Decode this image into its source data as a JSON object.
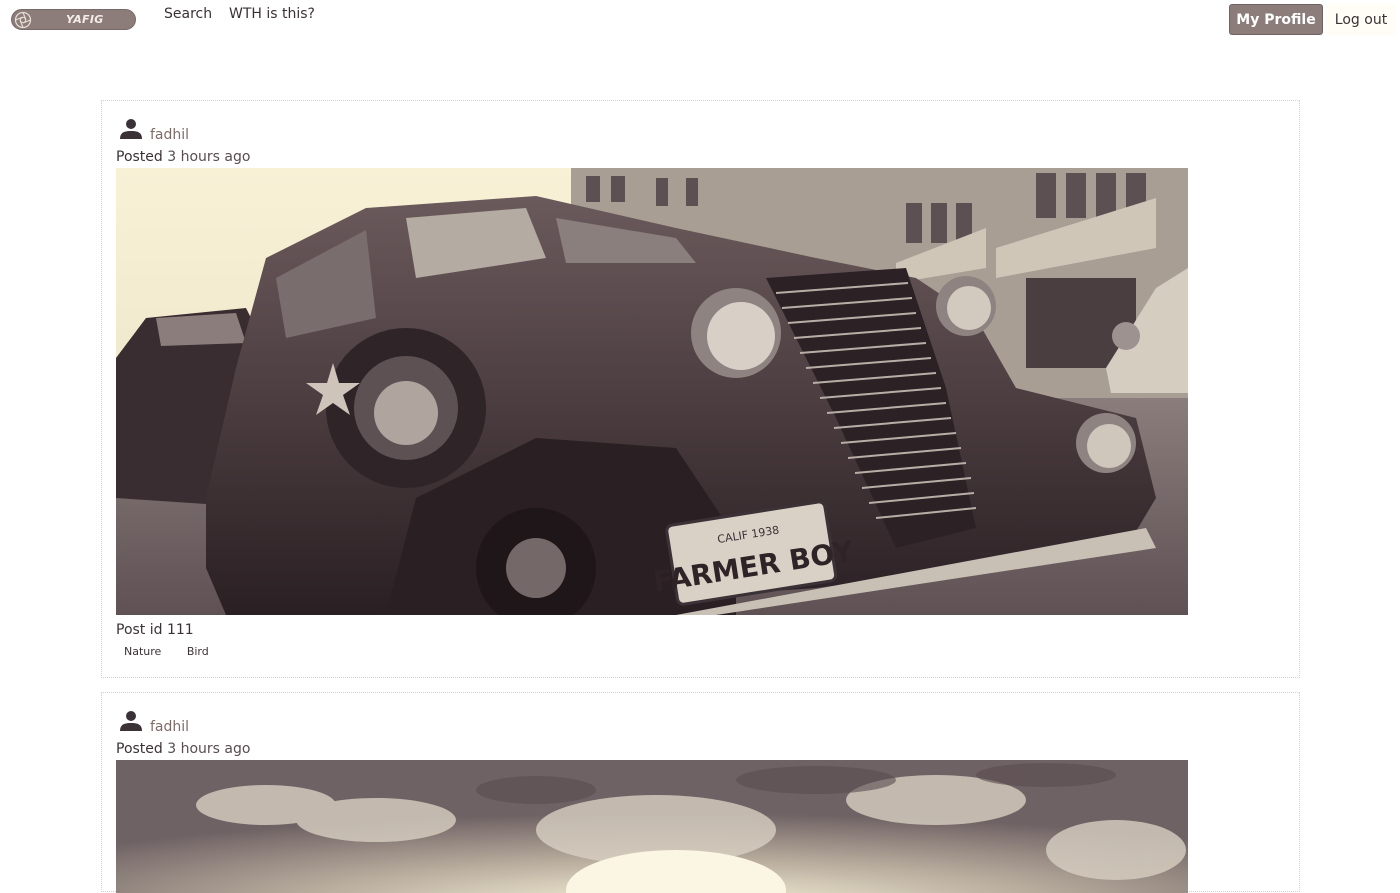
{
  "header": {
    "logo_text": "YAFIG",
    "nav": [
      {
        "label": "Search"
      },
      {
        "label": "WTH is this?"
      }
    ],
    "profile_button": "My Profile",
    "logout_button": "Log out"
  },
  "posts": [
    {
      "username": "fadhil",
      "posted_prefix": "Posted",
      "posted_time": "3 hours ago",
      "caption": "Post id 111",
      "tags": [
        "Nature",
        "Bird"
      ],
      "image": {
        "icon": "photo-vintage-car",
        "plate_line1": "CALIF 1938",
        "plate_line2": "FARMER BOY"
      }
    },
    {
      "username": "fadhil",
      "posted_prefix": "Posted",
      "posted_time": "3 hours ago",
      "image": {
        "icon": "photo-cloudy-sky"
      }
    }
  ],
  "colors": {
    "accent": "#8c7d7a",
    "text": "#3b3237",
    "link": "#7d6b66",
    "sepia_light": "#f6efd3",
    "sepia_dark": "#2f2327"
  }
}
